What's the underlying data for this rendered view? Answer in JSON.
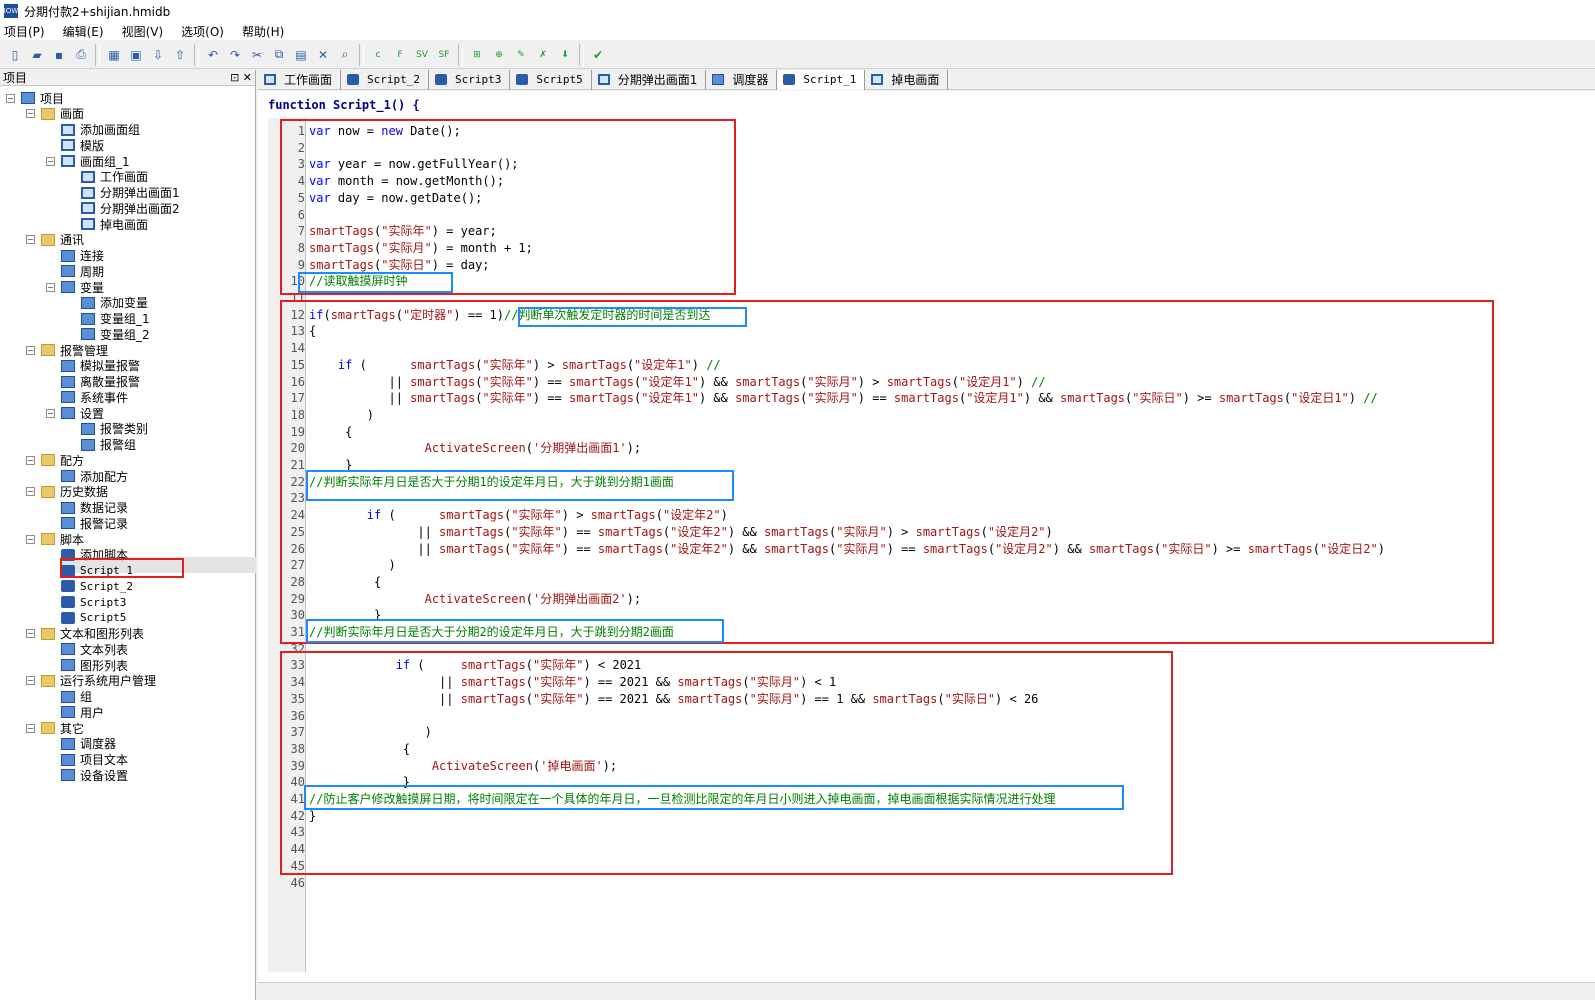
{
  "window": {
    "title": "分期付款2+shijian.hmidb"
  },
  "menu": [
    "项目(P)",
    "编辑(E)",
    "视图(V)",
    "选项(O)",
    "帮助(H)"
  ],
  "toolbar_icons": [
    "new-icon",
    "open-icon",
    "save-icon",
    "print-icon",
    "grid-icon",
    "screen-icon",
    "download-icon",
    "upload-icon",
    "undo-icon",
    "redo-icon",
    "cut-icon",
    "copy-icon",
    "paste-icon",
    "delete-icon",
    "find-icon",
    "c-icon",
    "f-icon",
    "sv-icon",
    "sf-icon",
    "insert-icon",
    "add-icon",
    "edit-icon",
    "remove-icon",
    "down-icon",
    "check-icon"
  ],
  "left_panel": {
    "title": "项目",
    "pin": "⊡ ✕"
  },
  "tree": [
    {
      "label": "项目",
      "lvl": 0,
      "exp": "−",
      "icon": "project"
    },
    {
      "label": "画面",
      "lvl": 1,
      "exp": "−",
      "icon": "folder"
    },
    {
      "label": "添加画面组",
      "lvl": 2,
      "icon": "screen"
    },
    {
      "label": "模版",
      "lvl": 2,
      "icon": "screen"
    },
    {
      "label": "画面组_1",
      "lvl": 2,
      "exp": "−",
      "icon": "screen"
    },
    {
      "label": "工作画面",
      "lvl": 3,
      "icon": "screen"
    },
    {
      "label": "分期弹出画面1",
      "lvl": 3,
      "icon": "screen"
    },
    {
      "label": "分期弹出画面2",
      "lvl": 3,
      "icon": "screen"
    },
    {
      "label": "掉电画面",
      "lvl": 3,
      "icon": "screen"
    },
    {
      "label": "通讯",
      "lvl": 1,
      "exp": "−",
      "icon": "folder"
    },
    {
      "label": "连接",
      "lvl": 2,
      "icon": "generic"
    },
    {
      "label": "周期",
      "lvl": 2,
      "icon": "generic"
    },
    {
      "label": "变量",
      "lvl": 2,
      "exp": "−",
      "icon": "generic"
    },
    {
      "label": "添加变量",
      "lvl": 3,
      "icon": "generic"
    },
    {
      "label": "变量组_1",
      "lvl": 3,
      "icon": "generic"
    },
    {
      "label": "变量组_2",
      "lvl": 3,
      "icon": "generic"
    },
    {
      "label": "报警管理",
      "lvl": 1,
      "exp": "−",
      "icon": "folder"
    },
    {
      "label": "模拟量报警",
      "lvl": 2,
      "icon": "generic"
    },
    {
      "label": "离散量报警",
      "lvl": 2,
      "icon": "generic"
    },
    {
      "label": "系统事件",
      "lvl": 2,
      "icon": "generic"
    },
    {
      "label": "设置",
      "lvl": 2,
      "exp": "−",
      "icon": "generic"
    },
    {
      "label": "报警类别",
      "lvl": 3,
      "icon": "generic"
    },
    {
      "label": "报警组",
      "lvl": 3,
      "icon": "generic"
    },
    {
      "label": "配方",
      "lvl": 1,
      "exp": "−",
      "icon": "folder"
    },
    {
      "label": "添加配方",
      "lvl": 2,
      "icon": "generic"
    },
    {
      "label": "历史数据",
      "lvl": 1,
      "exp": "−",
      "icon": "folder"
    },
    {
      "label": "数据记录",
      "lvl": 2,
      "icon": "generic"
    },
    {
      "label": "报警记录",
      "lvl": 2,
      "icon": "generic"
    },
    {
      "label": "脚本",
      "lvl": 1,
      "exp": "−",
      "icon": "folder"
    },
    {
      "label": "添加脚本",
      "lvl": 2,
      "icon": "script"
    },
    {
      "label": "Script_1",
      "lvl": 2,
      "icon": "script",
      "mono": true,
      "selected": true
    },
    {
      "label": "Script_2",
      "lvl": 2,
      "icon": "script",
      "mono": true
    },
    {
      "label": "Script3",
      "lvl": 2,
      "icon": "script",
      "mono": true
    },
    {
      "label": "Script5",
      "lvl": 2,
      "icon": "script",
      "mono": true
    },
    {
      "label": "文本和图形列表",
      "lvl": 1,
      "exp": "−",
      "icon": "folder"
    },
    {
      "label": "文本列表",
      "lvl": 2,
      "icon": "generic"
    },
    {
      "label": "图形列表",
      "lvl": 2,
      "icon": "generic"
    },
    {
      "label": "运行系统用户管理",
      "lvl": 1,
      "exp": "−",
      "icon": "folder"
    },
    {
      "label": "组",
      "lvl": 2,
      "icon": "generic"
    },
    {
      "label": "用户",
      "lvl": 2,
      "icon": "generic"
    },
    {
      "label": "其它",
      "lvl": 1,
      "exp": "−",
      "icon": "folder"
    },
    {
      "label": "调度器",
      "lvl": 2,
      "icon": "generic"
    },
    {
      "label": "项目文本",
      "lvl": 2,
      "icon": "generic"
    },
    {
      "label": "设备设置",
      "lvl": 2,
      "icon": "generic"
    }
  ],
  "tabs": [
    {
      "label": "工作画面",
      "icon": "screen"
    },
    {
      "label": "Script_2",
      "icon": "script",
      "mono": true
    },
    {
      "label": "Script3",
      "icon": "script",
      "mono": true
    },
    {
      "label": "Script5",
      "icon": "script",
      "mono": true
    },
    {
      "label": "分期弹出画面1",
      "icon": "screen"
    },
    {
      "label": "调度器",
      "icon": "generic"
    },
    {
      "label": "Script_1",
      "icon": "script",
      "mono": true,
      "active": true
    },
    {
      "label": "掉电画面",
      "icon": "screen"
    }
  ],
  "editor": {
    "function_header": "function Script_1() {",
    "line_count": 46,
    "lines": [
      "var now = new Date();",
      "",
      "var year = now.getFullYear();",
      "var month = now.getMonth();",
      "var day = now.getDate();",
      "",
      "smartTags(\"实际年\") = year;",
      "smartTags(\"实际月\") = month + 1;",
      "smartTags(\"实际日\") = day;",
      "//读取触摸屏时钟",
      "",
      "if(smartTags(\"定时器\") == 1)//判断单次触发定时器的时间是否到达",
      "{",
      "",
      "    if (      smartTags(\"实际年\") > smartTags(\"设定年1\") //",
      "           || smartTags(\"实际年\") == smartTags(\"设定年1\") && smartTags(\"实际月\") > smartTags(\"设定月1\") //",
      "           || smartTags(\"实际年\") == smartTags(\"设定年1\") && smartTags(\"实际月\") == smartTags(\"设定月1\") && smartTags(\"实际日\") >= smartTags(\"设定日1\") //",
      "        )",
      "     {",
      "                ActivateScreen('分期弹出画面1');",
      "     }",
      "//判断实际年月日是否大于分期1的设定年月日，大于跳到分期1画面",
      "",
      "        if (      smartTags(\"实际年\") > smartTags(\"设定年2\")",
      "               || smartTags(\"实际年\") == smartTags(\"设定年2\") && smartTags(\"实际月\") > smartTags(\"设定月2\")",
      "               || smartTags(\"实际年\") == smartTags(\"设定年2\") && smartTags(\"实际月\") == smartTags(\"设定月2\") && smartTags(\"实际日\") >= smartTags(\"设定日2\")",
      "           )",
      "         {",
      "                ActivateScreen('分期弹出画面2');",
      "         }",
      "//判断实际年月日是否大于分期2的设定年月日，大于跳到分期2画面",
      "",
      "            if (     smartTags(\"实际年\") < 2021",
      "                  || smartTags(\"实际年\") == 2021 && smartTags(\"实际月\") < 1",
      "                  || smartTags(\"实际年\") == 2021 && smartTags(\"实际月\") == 1 && smartTags(\"实际日\") < 26",
      "",
      "                )",
      "             {",
      "                 ActivateScreen('掉电画面');",
      "             }",
      "//防止客户修改触摸屏日期，将时间限定在一个具体的年月日，一旦检测比限定的年月日小则进入掉电画面，掉电画面根据实际情况进行处理",
      "}",
      "",
      "",
      "",
      ""
    ]
  }
}
